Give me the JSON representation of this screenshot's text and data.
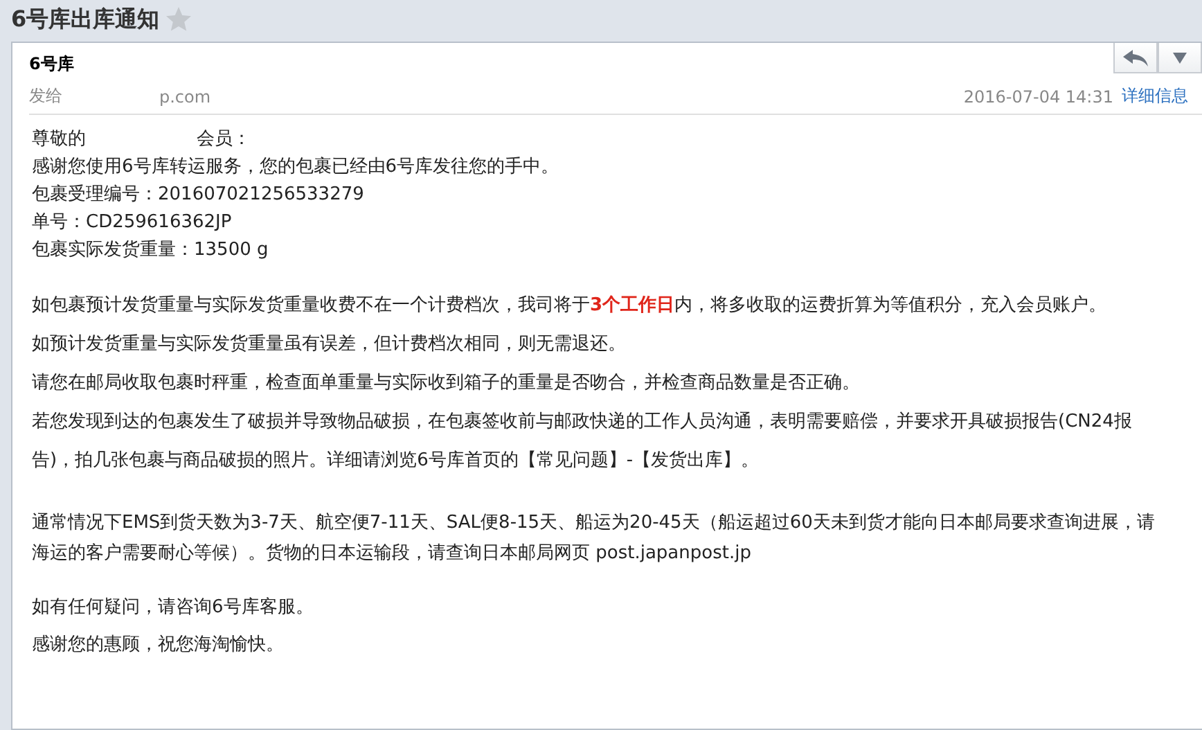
{
  "title": "6号库出库通知",
  "starred": false,
  "header": {
    "sender": "6号库",
    "recipient_label": "发给",
    "recipient_tail": "p.com",
    "date": "2016-07-04 14:31",
    "details_link": "详细信息"
  },
  "intro": {
    "greeting_start": "尊敬的",
    "greeting_end": "会员：",
    "lines": [
      "感谢您使用6号库转运服务，您的包裹已经由6号库发往您的手中。",
      "包裹受理编号：201607021256533279",
      "单号：CD259616362JP",
      "包裹实际发货重量：13500 g"
    ]
  },
  "notices": [
    {
      "segments": [
        {
          "text": "如包裹预计发货重量与实际发货重量收费不在一个计费档次，我司将于",
          "highlight": false
        },
        {
          "text": "3个工作日",
          "highlight": true
        },
        {
          "text": "内，将多收取的运费折算为等值积分，充入会员账户。",
          "highlight": false
        }
      ]
    },
    {
      "segments": [
        {
          "text": "如预计发货重量与实际发货重量虽有误差，但计费档次相同，则无需退还。",
          "highlight": false
        }
      ]
    },
    {
      "segments": [
        {
          "text": "请您在邮局收取包裹时秤重，检查面单重量与实际收到箱子的重量是否吻合，并检查商品数量是否正确。",
          "highlight": false
        }
      ]
    },
    {
      "segments": [
        {
          "text": "若您发现到达的包裹发生了破损并导致物品破损，在包裹签收前与邮政快递的工作人员沟通，表明需要赔偿，并要求开具破损报告(CN24报告)，拍几张包裹与商品破损的照片。详细请浏览6号库首页的【常见问题】-【发货出库】。",
          "highlight": false
        }
      ]
    }
  ],
  "shipping": "通常情况下EMS到货天数为3-7天、航空便7-11天、SAL便8-15天、船运为20-45天（船运超过60天未到货才能向日本邮局要求查询进展，请海运的客户需要耐心等候）。货物的日本运输段，请查询日本邮局网页 post.japanpost.jp",
  "closing": [
    "如有任何疑问，请咨询6号库客服。",
    "感谢您的惠顾，祝您海淘愉快。"
  ]
}
